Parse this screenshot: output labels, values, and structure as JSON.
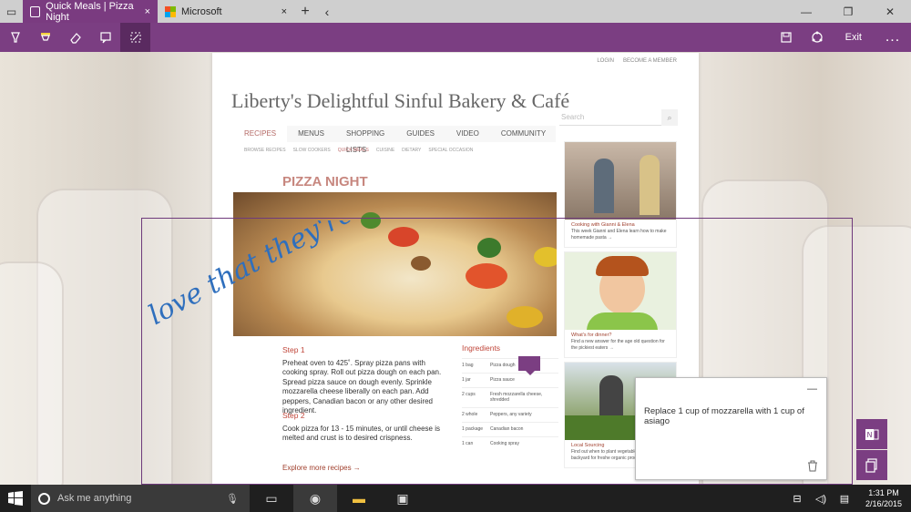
{
  "tabs": [
    {
      "label": "Quick Meals | Pizza Night",
      "active": true
    },
    {
      "label": "Microsoft",
      "active": false
    }
  ],
  "icons": {
    "tab_preview": "tab-preview-icon",
    "close": "×",
    "new_tab": "+",
    "back": "‹",
    "minimize": "—",
    "restore": "❐",
    "close_window": "✕"
  },
  "toolbar": {
    "tools": [
      "pen-icon",
      "highlighter-icon",
      "eraser-icon",
      "add-note-icon",
      "clip-icon"
    ],
    "save": "save-icon",
    "share": "share-icon",
    "exit_label": "Exit",
    "more_label": "..."
  },
  "accent": "#7b3e82",
  "site": {
    "top_links": [
      "LOGIN",
      "BECOME A MEMBER"
    ],
    "title": "Liberty's Delightful Sinful Bakery & Café",
    "search_placeholder": "Search",
    "nav": [
      "RECIPES",
      "MENUS",
      "SHOPPING LISTS",
      "GUIDES",
      "VIDEO",
      "COMMUNITY"
    ],
    "subnav": [
      "BROWSE RECIPES",
      "SLOW COOKERS",
      "QUICK MEALS",
      "CUISINE",
      "DIETARY",
      "SPECIAL OCCASION"
    ],
    "recipe_title": "PIZZA NIGHT",
    "step1_title": "Step 1",
    "step1_text": "Preheat oven to 425˚. Spray pizza pans with cooking spray. Roll out pizza dough on each pan. Spread pizza sauce on dough evenly. Sprinkle mozzarella cheese liberally on each pan. Add peppers, Canadian bacon or any other desired ingredient.",
    "step2_title": "Step 2",
    "step2_text": "Cook pizza for 13 - 15 minutes, or until cheese is melted and  crust is to desired crispness.",
    "ingredients_title": "Ingredients",
    "ingredients": [
      {
        "qty": "1 bag",
        "name": "Pizza dough"
      },
      {
        "qty": "1 jar",
        "name": "Pizza sauce"
      },
      {
        "qty": "2 cups",
        "name": "Fresh mozzarella cheese, shredded"
      },
      {
        "qty": "2 whole",
        "name": "Peppers, any variety"
      },
      {
        "qty": "1 package",
        "name": "Canadian bacon"
      },
      {
        "qty": "1 can",
        "name": "Cooking spray"
      }
    ],
    "explore": "Explore more recipes →",
    "side_cards": [
      {
        "title": "Cooking with Gianni & Elena",
        "text": "This week Gianni and Elena learn how to make homemade pasta →"
      },
      {
        "title": "What's for dinner?",
        "text": "Find a new answer for the age old question for the pickiest eaters →"
      },
      {
        "title": "Local Sourcing",
        "text": "Find out when to plant vegetables in your own backyard for freshe organic produce →"
      }
    ]
  },
  "ink_text": "love that they're posting recipes!",
  "note": {
    "text": "Replace 1 cup of mozzarella with 1 cup of asiago",
    "minimize": "—",
    "delete": "delete-icon"
  },
  "side_buttons": [
    "onenote-icon",
    "copy-icon"
  ],
  "taskbar": {
    "search_placeholder": "Ask me anything",
    "apps": [
      "task-view-icon",
      "edge-icon",
      "file-explorer-icon",
      "store-icon"
    ],
    "time": "1:31 PM",
    "date": "2/16/2015"
  }
}
